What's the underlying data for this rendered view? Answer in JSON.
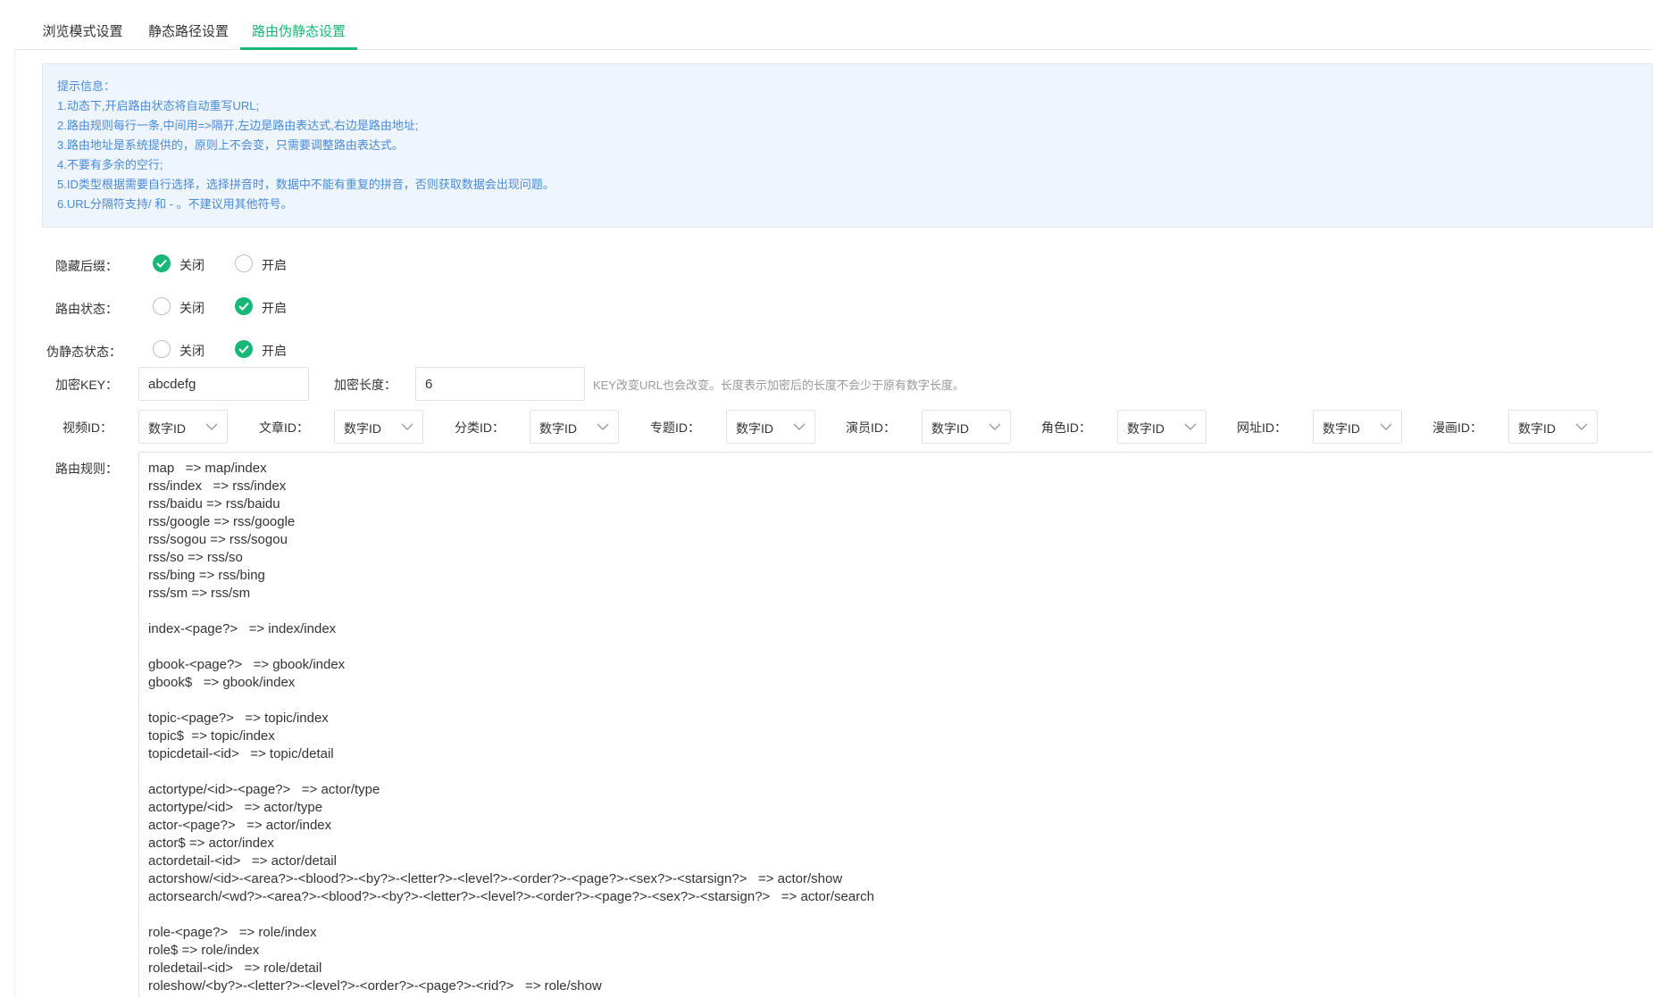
{
  "tabs": [
    {
      "label": "浏览模式设置",
      "active": false
    },
    {
      "label": "静态路径设置",
      "active": false
    },
    {
      "label": "路由伪静态设置",
      "active": true
    }
  ],
  "tips": [
    "提示信息：",
    "1.动态下,开启路由状态将自动重写URL;",
    "2.路由规则每行一条,中间用=>隔开,左边是路由表达式,右边是路由地址;",
    "3.路由地址是系统提供的，原则上不会变，只需要调整路由表达式。",
    "4.不要有多余的空行;",
    "5.ID类型根据需要自行选择，选择拼音时，数据中不能有重复的拼音，否则获取数据会出现问题。",
    "6.URL分隔符支持/ 和 - 。不建议用其他符号。"
  ],
  "options": {
    "off": "关闭",
    "on": "开启"
  },
  "hide_suffix": {
    "label": "隐藏后缀：",
    "value": "off"
  },
  "route_status": {
    "label": "路由状态：",
    "value": "on"
  },
  "pseudo_status": {
    "label": "伪静态状态：",
    "value": "on"
  },
  "encrypt": {
    "key_label": "加密KEY：",
    "key_value": "abcdefg",
    "length_label": "加密长度：",
    "length_value": "6",
    "hint": "KEY改变URL也会改变。长度表示加密后的长度不会少于原有数字长度。"
  },
  "id_types": [
    {
      "label": "视频ID：",
      "value": "数字ID"
    },
    {
      "label": "文章ID：",
      "value": "数字ID"
    },
    {
      "label": "分类ID：",
      "value": "数字ID"
    },
    {
      "label": "专题ID：",
      "value": "数字ID"
    },
    {
      "label": "演员ID：",
      "value": "数字ID"
    },
    {
      "label": "角色ID：",
      "value": "数字ID"
    },
    {
      "label": "网址ID：",
      "value": "数字ID"
    },
    {
      "label": "漫画ID：",
      "value": "数字ID"
    }
  ],
  "rules": {
    "label": "路由规则：",
    "lines": [
      "map   => map/index",
      "rss/index   => rss/index",
      "rss/baidu => rss/baidu",
      "rss/google => rss/google",
      "rss/sogou => rss/sogou",
      "rss/so => rss/so",
      "rss/bing => rss/bing",
      "rss/sm => rss/sm",
      "",
      "index-<page?>   => index/index",
      "",
      "gbook-<page?>   => gbook/index",
      "gbook$   => gbook/index",
      "",
      "topic-<page?>   => topic/index",
      "topic$  => topic/index",
      "topicdetail-<id>   => topic/detail",
      "",
      "actortype/<id>-<page?>   => actor/type",
      "actortype/<id>   => actor/type",
      "actor-<page?>   => actor/index",
      "actor$ => actor/index",
      "actordetail-<id>   => actor/detail",
      "actorshow/<id>-<area?>-<blood?>-<by?>-<letter?>-<level?>-<order?>-<page?>-<sex?>-<starsign?>   => actor/show",
      "actorsearch/<wd?>-<area?>-<blood?>-<by?>-<letter?>-<level?>-<order?>-<page?>-<sex?>-<starsign?>   => actor/search",
      "",
      "role-<page?>   => role/index",
      "role$ => role/index",
      "roledetail-<id>   => role/detail",
      "roleshow/<by?>-<letter?>-<level?>-<order?>-<page?>-<rid?>   => role/show"
    ]
  },
  "colors": {
    "accent": "#16b777",
    "tip_text": "#4a8ad8",
    "tip_bg": "#eef5fd"
  }
}
